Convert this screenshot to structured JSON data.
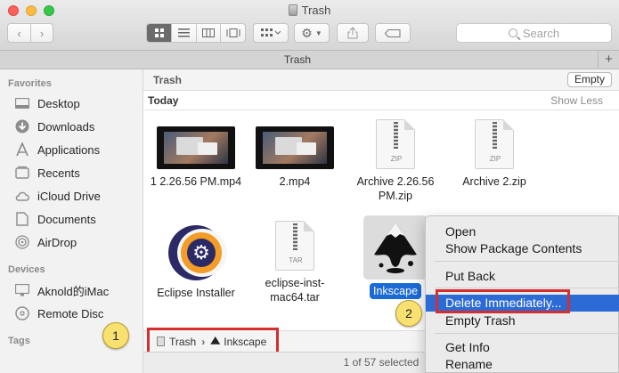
{
  "window": {
    "title": "Trash"
  },
  "toolbar": {
    "back_glyph": "‹",
    "forward_glyph": "›",
    "search_placeholder": "Search"
  },
  "tabbar": {
    "title": "Trash",
    "add_glyph": "+"
  },
  "sidebar": {
    "favorites_header": "Favorites",
    "favorites": [
      {
        "label": "Desktop",
        "icon": "desktop-icon"
      },
      {
        "label": "Downloads",
        "icon": "downloads-icon"
      },
      {
        "label": "Applications",
        "icon": "applications-icon"
      },
      {
        "label": "Recents",
        "icon": "recents-icon"
      },
      {
        "label": "iCloud Drive",
        "icon": "cloud-icon"
      },
      {
        "label": "Documents",
        "icon": "documents-icon"
      },
      {
        "label": "AirDrop",
        "icon": "airdrop-icon"
      }
    ],
    "devices_header": "Devices",
    "devices": [
      {
        "label": "Aknold的iMac",
        "icon": "imac-icon"
      },
      {
        "label": "Remote Disc",
        "icon": "disc-icon"
      }
    ],
    "tags_header": "Tags"
  },
  "content": {
    "path_title": "Trash",
    "empty_button": "Empty",
    "section": "Today",
    "show_less": "Show Less",
    "files": [
      {
        "name": "1 2.26.56 PM.mp4",
        "kind": "video"
      },
      {
        "name": "2.mp4",
        "kind": "video"
      },
      {
        "name": "Archive 2.26.56 PM.zip",
        "kind": "ZIP"
      },
      {
        "name": "Archive 2.zip",
        "kind": "ZIP"
      },
      {
        "name": "Eclipse Installer",
        "kind": "app"
      },
      {
        "name": "eclipse-inst-mac64.tar",
        "kind": "TAR"
      },
      {
        "name": "Inkscape",
        "kind": "app",
        "selected": true
      }
    ]
  },
  "pathbar": {
    "first": "Trash",
    "second": "Inkscape"
  },
  "status": {
    "text": "1 of 57 selected"
  },
  "annotations": {
    "badge1": "1",
    "badge2": "2"
  },
  "context_menu": {
    "items": [
      "Open",
      "Show Package Contents",
      "Put Back",
      "Delete Immediately...",
      "Empty Trash",
      "Get Info",
      "Rename"
    ],
    "highlighted": "Delete Immediately..."
  },
  "colors": {
    "selection": "#2c6bd5",
    "annotation_box": "#d32f2f",
    "badge": "#f8e071"
  }
}
